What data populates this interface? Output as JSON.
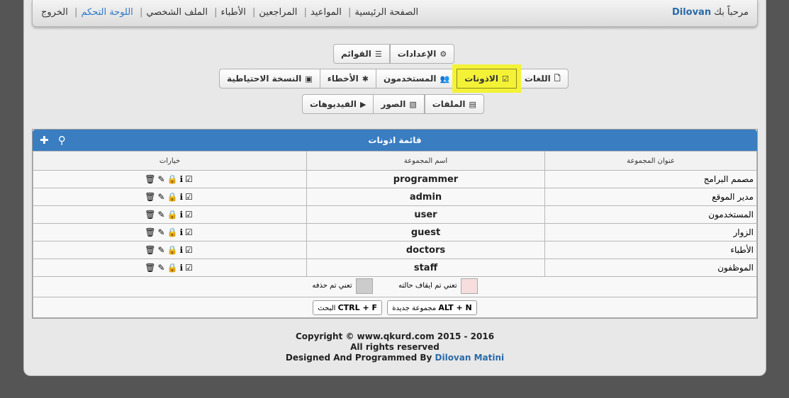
{
  "topbar": {
    "welcome_prefix": "مرحباً بك",
    "username": "Dilovan",
    "nav": [
      "الصفحة الرئيسية",
      "المواعيد",
      "المراجعين",
      "الأطباء",
      "الملف الشخصي",
      "اللوحة التحكم",
      "الخروج"
    ]
  },
  "toolbar": {
    "row1": [
      "الإعدادات",
      "القوائم"
    ],
    "row2": [
      "اللغات",
      "الاذونات",
      "المستخدمون",
      "الأخطاء",
      "النسخة الاحتياطية"
    ],
    "row3": [
      "الملفات",
      "الصور",
      "الفيديوهات"
    ],
    "highlight_color": "#f4f236"
  },
  "panel": {
    "title": "قائمة اذونات",
    "headers": {
      "title": "عنوان المجموعة",
      "name": "اسم المجموعة",
      "options": "خيارات"
    },
    "rows": [
      {
        "title": "مصمم البرامج",
        "name": "programmer"
      },
      {
        "title": "مدير الموقع",
        "name": "admin"
      },
      {
        "title": "المستخدمون",
        "name": "user"
      },
      {
        "title": "الزوار",
        "name": "guest"
      },
      {
        "title": "الأطباء",
        "name": "doctors"
      },
      {
        "title": "الموظفون",
        "name": "staff"
      }
    ],
    "legend": [
      {
        "text": "تعني تم ايقاف حالته",
        "color": "#f6dede"
      },
      {
        "text": "تعني تم حذفه",
        "color": "#cccccc"
      }
    ],
    "shortcuts": [
      {
        "keys": "ALT + N",
        "label": "مجموعة جديدة"
      },
      {
        "keys": "CTRL + F",
        "label": "البحث"
      }
    ],
    "header_color": "#3a7dc1"
  },
  "footer": {
    "line1": "Copyright © www.qkurd.com 2015 - 2016",
    "line2": "All rights reserved",
    "line3_prefix": "Designed And Programmed By",
    "author": "Dilovan Matini"
  }
}
